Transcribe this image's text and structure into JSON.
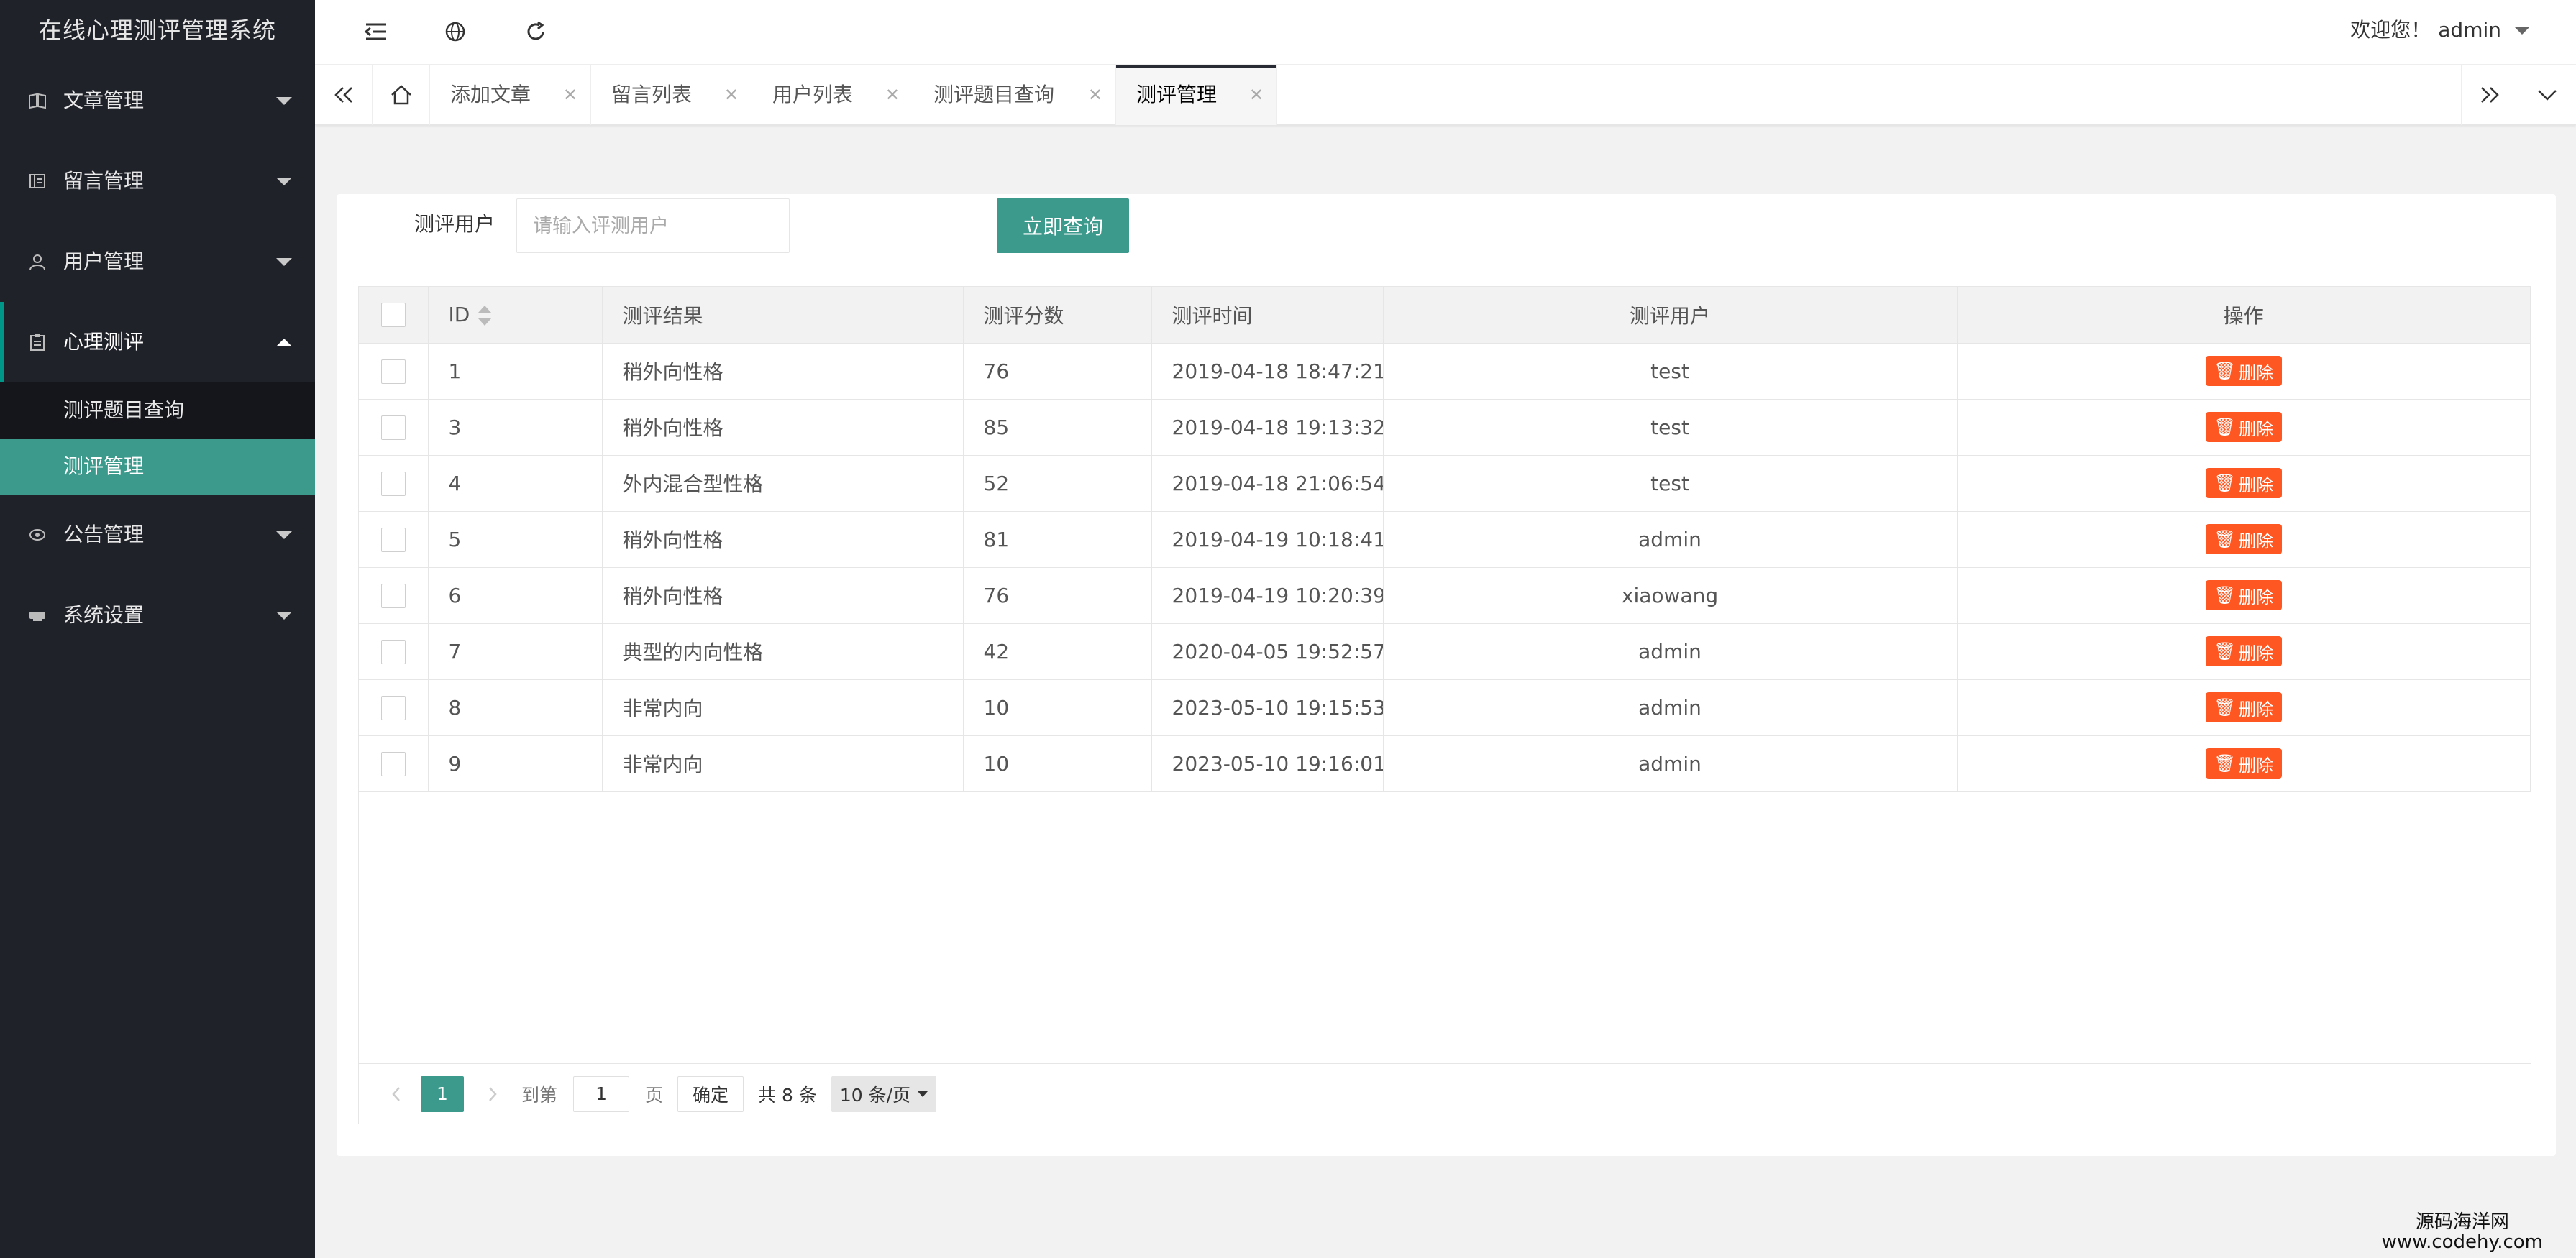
{
  "app": {
    "title": "在线心理测评管理系统"
  },
  "sidebar": {
    "items": [
      {
        "label": "文章管理",
        "icon": "book-icon",
        "expanded": false
      },
      {
        "label": "留言管理",
        "icon": "message-icon",
        "expanded": false
      },
      {
        "label": "用户管理",
        "icon": "user-icon",
        "expanded": false
      },
      {
        "label": "心理测评",
        "icon": "clipboard-icon",
        "expanded": true,
        "children": [
          {
            "label": "测评题目查询",
            "active": false
          },
          {
            "label": "测评管理",
            "active": true
          }
        ]
      },
      {
        "label": "公告管理",
        "icon": "announce-icon",
        "expanded": false
      },
      {
        "label": "系统设置",
        "icon": "settings-icon",
        "expanded": false
      }
    ]
  },
  "header": {
    "welcome": "欢迎您！",
    "username": "admin"
  },
  "tabs": [
    {
      "label": "添加文章",
      "active": false
    },
    {
      "label": "留言列表",
      "active": false
    },
    {
      "label": "用户列表",
      "active": false
    },
    {
      "label": "测评题目查询",
      "active": false
    },
    {
      "label": "测评管理",
      "active": true
    }
  ],
  "search": {
    "label": "测评用户",
    "placeholder": "请输入评测用户",
    "value": "",
    "button": "立即查询"
  },
  "table": {
    "columns": [
      "ID",
      "测评结果",
      "测评分数",
      "测评时间",
      "测评用户",
      "操作"
    ],
    "delete_label": "删除",
    "rows": [
      {
        "id": "1",
        "result": "稍外向性格",
        "score": "76",
        "time": "2019-04-18 18:47:21",
        "user": "test"
      },
      {
        "id": "3",
        "result": "稍外向性格",
        "score": "85",
        "time": "2019-04-18 19:13:32",
        "user": "test"
      },
      {
        "id": "4",
        "result": "外内混合型性格",
        "score": "52",
        "time": "2019-04-18 21:06:54",
        "user": "test"
      },
      {
        "id": "5",
        "result": "稍外向性格",
        "score": "81",
        "time": "2019-04-19 10:18:41",
        "user": "admin"
      },
      {
        "id": "6",
        "result": "稍外向性格",
        "score": "76",
        "time": "2019-04-19 10:20:39",
        "user": "xiaowang"
      },
      {
        "id": "7",
        "result": "典型的内向性格",
        "score": "42",
        "time": "2020-04-05 19:52:57",
        "user": "admin"
      },
      {
        "id": "8",
        "result": "非常内向",
        "score": "10",
        "time": "2023-05-10 19:15:53",
        "user": "admin"
      },
      {
        "id": "9",
        "result": "非常内向",
        "score": "10",
        "time": "2023-05-10 19:16:01",
        "user": "admin"
      }
    ]
  },
  "pager": {
    "current": "1",
    "goto_label": "到第",
    "goto_value": "1",
    "page_label": "页",
    "confirm": "确定",
    "total": "共 8 条",
    "page_size": "10 条/页"
  },
  "watermark": {
    "line1": "源码海洋网",
    "line2": "www.codehy.com"
  },
  "colors": {
    "accent": "#3b9a8c",
    "danger": "#ff5722",
    "sidebar": "#20222a"
  }
}
